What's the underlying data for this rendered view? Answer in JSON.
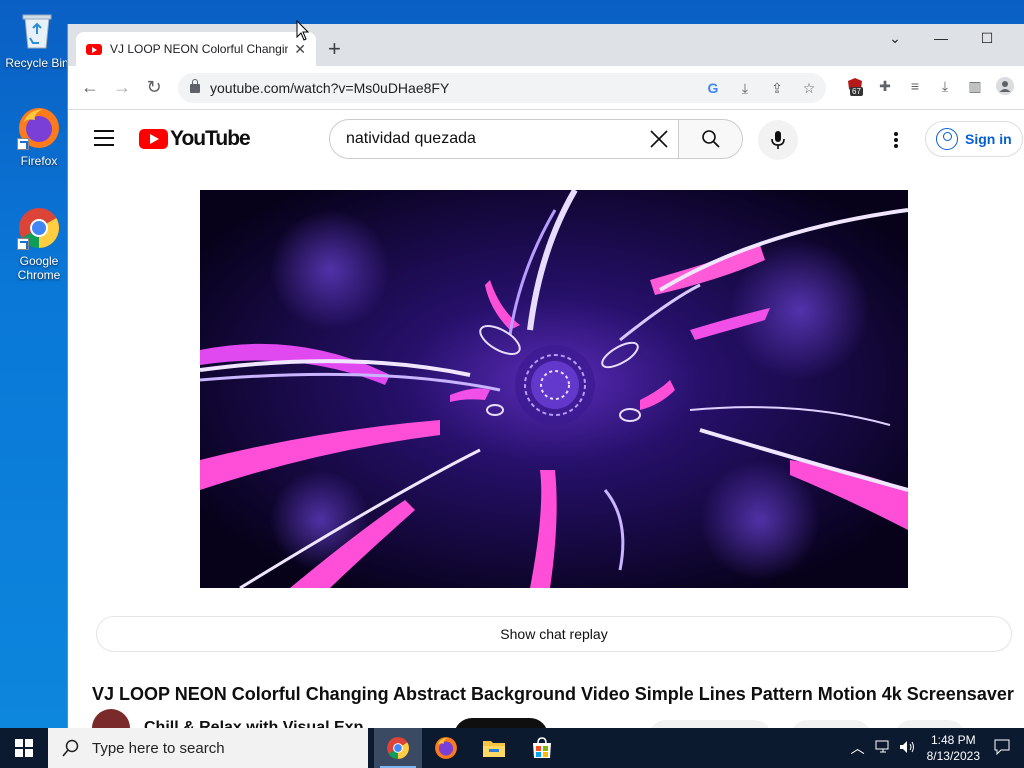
{
  "desktop": {
    "icons": [
      {
        "label": "Recycle Bin"
      },
      {
        "label": "Firefox"
      },
      {
        "label": "Google Chrome"
      }
    ]
  },
  "browser": {
    "tab_title": "VJ LOOP NEON Colorful Changing Abstract Background Video",
    "url": "youtube.com/watch?v=Ms0uDHae8FY",
    "extension_badge": "67"
  },
  "youtube": {
    "logo_text": "YouTube",
    "search_value": "natividad quezada",
    "sign_in_label": "Sign in",
    "chat_replay_label": "Show chat replay",
    "video_title": "VJ LOOP NEON Colorful Changing Abstract Background Video Simple Lines Pattern Motion 4k Screensaver",
    "channel_name": "Chill & Relax with Visual Exp"
  },
  "taskbar": {
    "search_placeholder": "Type here to search",
    "time": "1:48 PM",
    "date": "8/13/2023"
  },
  "colors": {
    "youtube_red": "#ff0000",
    "link_blue": "#065fd4",
    "desktop_blue": "#0a78d7",
    "taskbar": "#0c1a30"
  }
}
